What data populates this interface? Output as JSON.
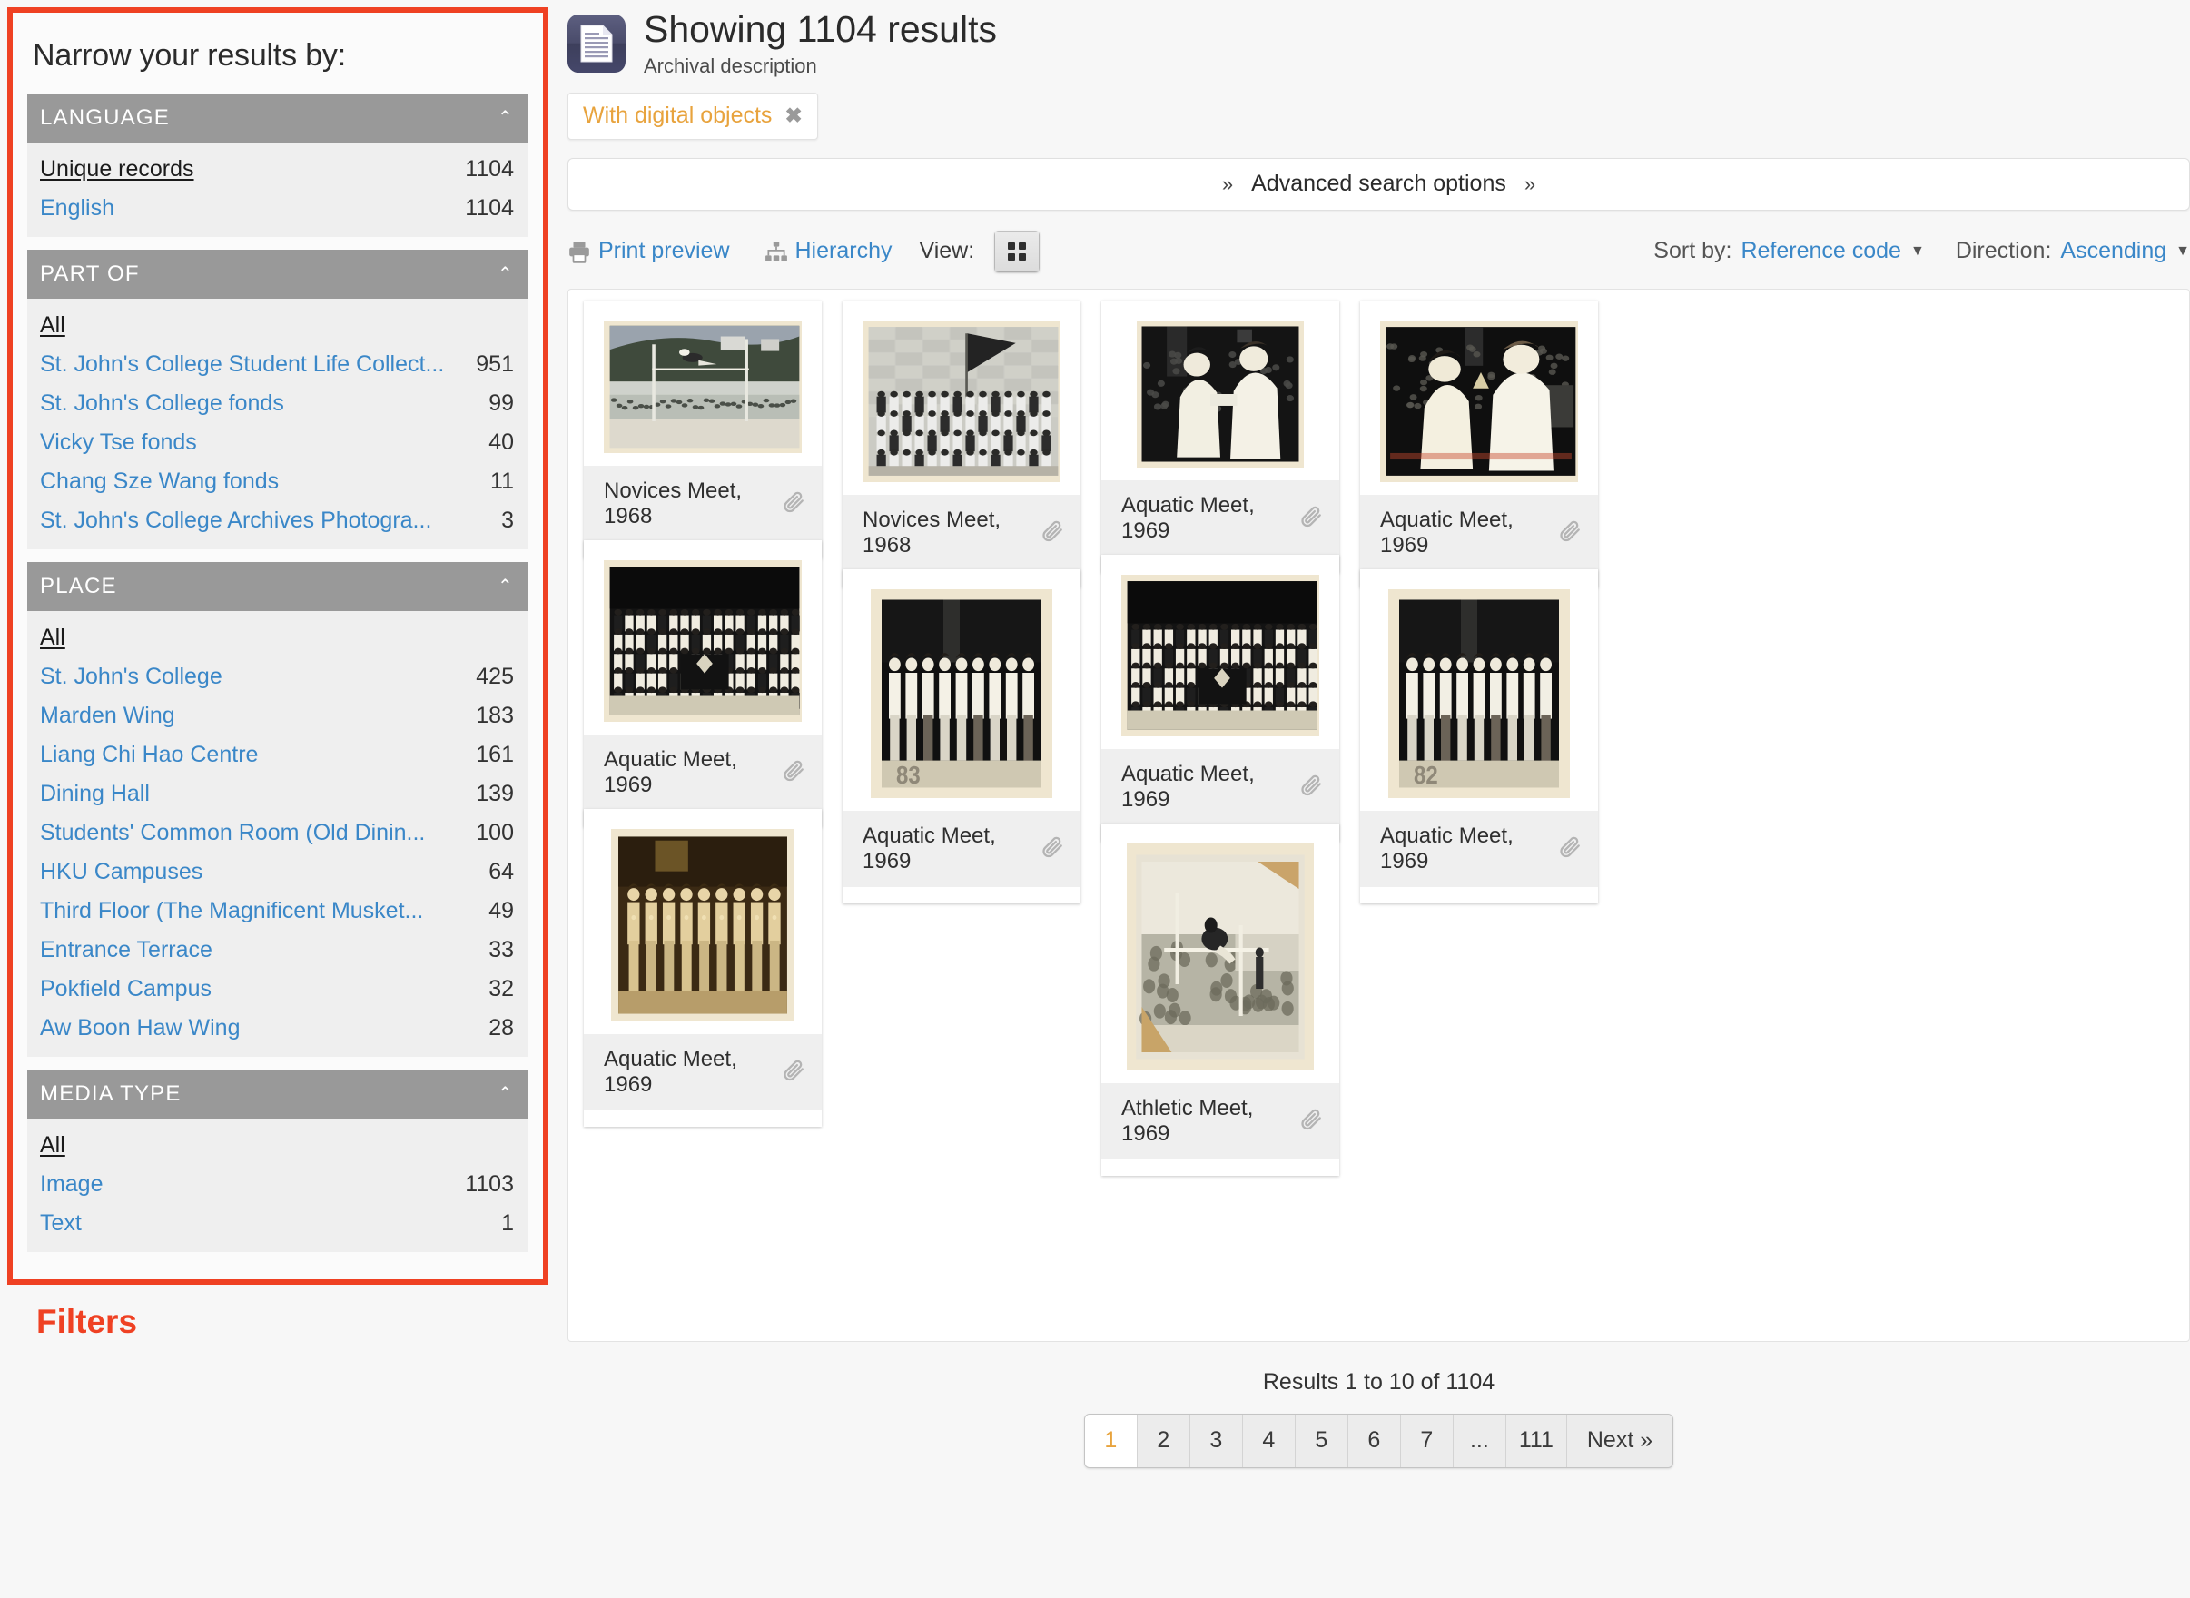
{
  "sidebar": {
    "title": "Narrow your results by:",
    "caption": "Filters",
    "facets": [
      {
        "heading": "LANGUAGE",
        "rows": [
          {
            "label": "Unique records",
            "count": "1104",
            "all": true
          },
          {
            "label": "English",
            "count": "1104",
            "all": false
          }
        ]
      },
      {
        "heading": "PART OF",
        "rows": [
          {
            "label": "All",
            "count": "",
            "all": true
          },
          {
            "label": "St. John's College Student Life Collect...",
            "count": "951",
            "all": false
          },
          {
            "label": "St. John's College fonds",
            "count": "99",
            "all": false
          },
          {
            "label": "Vicky Tse fonds",
            "count": "40",
            "all": false
          },
          {
            "label": "Chang Sze Wang fonds",
            "count": "11",
            "all": false
          },
          {
            "label": "St. John's College Archives Photogra...",
            "count": "3",
            "all": false
          }
        ]
      },
      {
        "heading": "PLACE",
        "rows": [
          {
            "label": "All",
            "count": "",
            "all": true
          },
          {
            "label": "St. John's College",
            "count": "425",
            "all": false
          },
          {
            "label": "Marden Wing",
            "count": "183",
            "all": false
          },
          {
            "label": "Liang Chi Hao Centre",
            "count": "161",
            "all": false
          },
          {
            "label": "Dining Hall",
            "count": "139",
            "all": false
          },
          {
            "label": "Students' Common Room (Old Dinin...",
            "count": "100",
            "all": false
          },
          {
            "label": "HKU Campuses",
            "count": "64",
            "all": false
          },
          {
            "label": "Third Floor (The Magnificent Musket...",
            "count": "49",
            "all": false
          },
          {
            "label": "Entrance Terrace",
            "count": "33",
            "all": false
          },
          {
            "label": "Pokfield Campus",
            "count": "32",
            "all": false
          },
          {
            "label": "Aw Boon Haw Wing",
            "count": "28",
            "all": false
          }
        ]
      },
      {
        "heading": "MEDIA TYPE",
        "rows": [
          {
            "label": "All",
            "count": "",
            "all": true
          },
          {
            "label": "Image",
            "count": "1103",
            "all": false
          },
          {
            "label": "Text",
            "count": "1",
            "all": false
          }
        ]
      }
    ]
  },
  "header": {
    "title": "Showing 1104 results",
    "subtitle": "Archival description",
    "icon": "document-icon",
    "chip": {
      "label": "With digital objects",
      "remove": "✖"
    }
  },
  "advanced_search": {
    "label": "Advanced search options",
    "left_icon": "chevron-double-down-icon",
    "right_icon": "chevron-double-down-icon"
  },
  "toolbar": {
    "print_preview": "Print preview",
    "hierarchy": "Hierarchy",
    "view_label": "View:",
    "view_card_icon": "grid-view-icon",
    "view_list_icon": "list-view-icon",
    "sort_by_label": "Sort by:",
    "sort_by_value": "Reference code",
    "direction_label": "Direction:",
    "direction_value": "Ascending"
  },
  "results": [
    {
      "title": "Novices Meet, 1968",
      "col": 0,
      "row": 0,
      "kind": "highjump-sand"
    },
    {
      "title": "Novices Meet, 1968",
      "col": 1,
      "row": 0,
      "kind": "group-flag"
    },
    {
      "title": "Aquatic Meet, 1969",
      "col": 2,
      "row": 0,
      "kind": "two-people-dark"
    },
    {
      "title": "Aquatic Meet, 1969",
      "col": 3,
      "row": 0,
      "kind": "trophy-presentation"
    },
    {
      "title": "Aquatic Meet, 1969",
      "col": 0,
      "row": 1,
      "kind": "big-group-banner"
    },
    {
      "title": "Aquatic Meet, 1969",
      "col": 1,
      "row": 1,
      "kind": "lineup-83"
    },
    {
      "title": "Aquatic Meet, 1969",
      "col": 2,
      "row": 1,
      "kind": "big-group-banner"
    },
    {
      "title": "Aquatic Meet, 1969",
      "col": 3,
      "row": 1,
      "kind": "lineup-82"
    },
    {
      "title": "Aquatic Meet, 1969",
      "col": 0,
      "row": 2,
      "kind": "sepia-lineup"
    },
    {
      "title": "Athletic Meet, 1969",
      "col": 2,
      "row": 2,
      "kind": "hurdle-jump"
    }
  ],
  "pagination": {
    "count_text": "Results 1 to 10 of 1104",
    "pages": [
      "1",
      "2",
      "3",
      "4",
      "5",
      "6",
      "7",
      "...",
      "111",
      "Next »"
    ],
    "active": "1"
  },
  "colors": {
    "accent_red": "#ef4123",
    "link_blue": "#3a87c8",
    "chip_orange": "#e8a33d",
    "facet_header_gray": "#999999",
    "facet_body_gray": "#efefef"
  }
}
